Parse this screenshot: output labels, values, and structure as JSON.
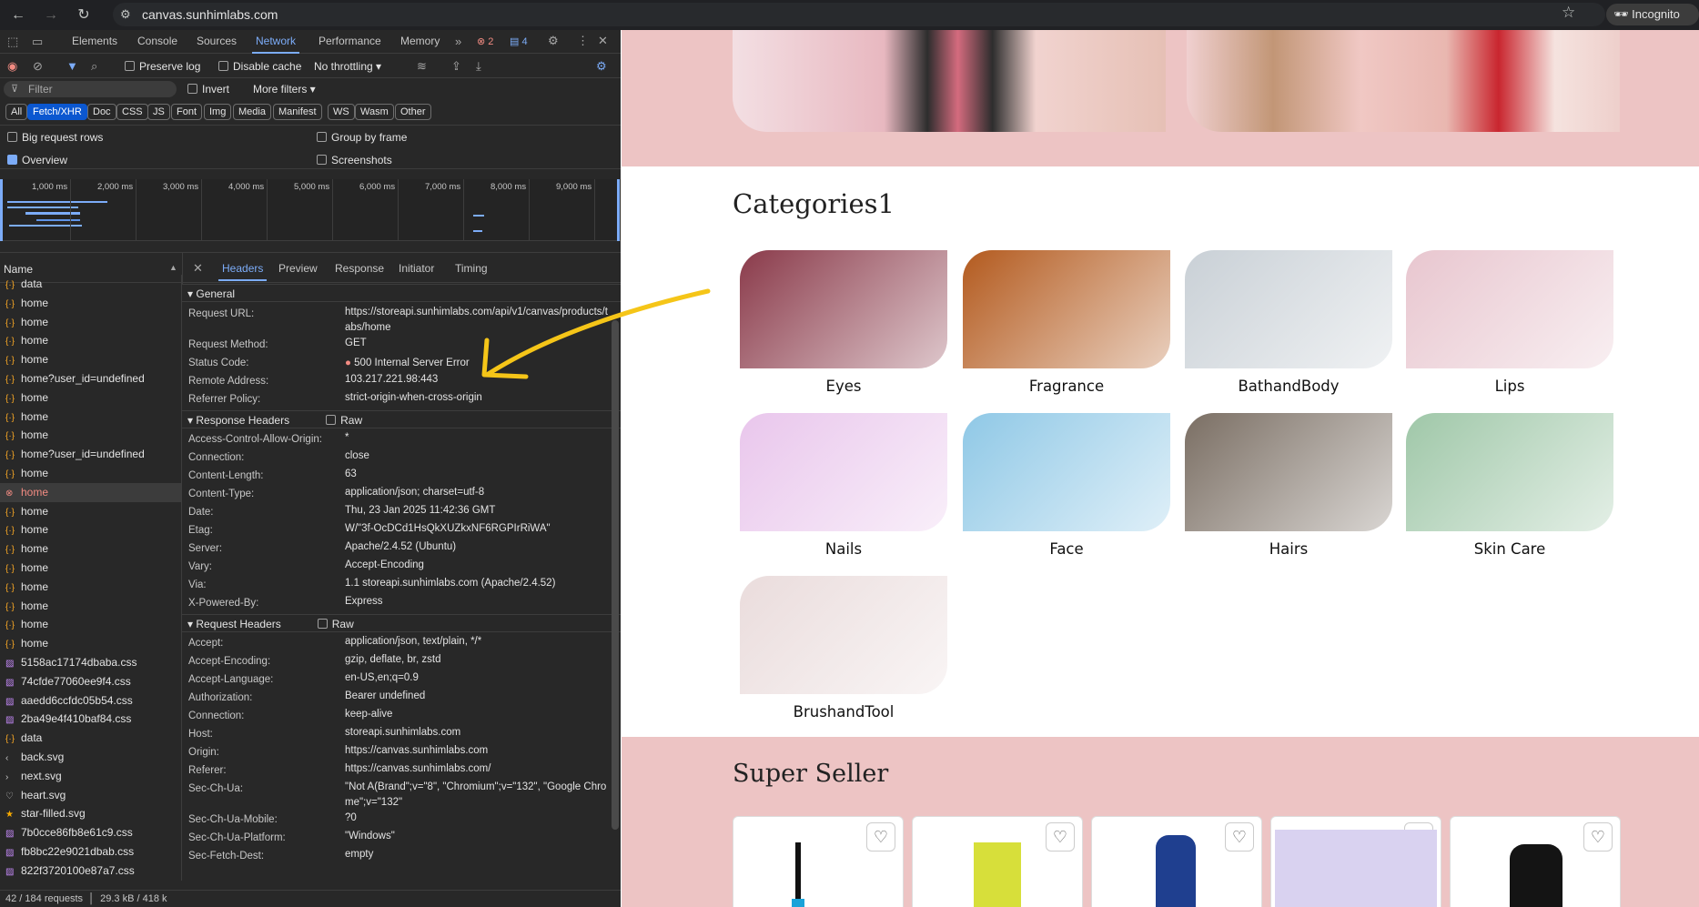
{
  "browser": {
    "url": "canvas.sunhimlabs.com",
    "profile": "Incognito (2)"
  },
  "devtools": {
    "tabs": [
      "Elements",
      "Console",
      "Sources",
      "Network",
      "Performance",
      "Memory"
    ],
    "active_tab": "Network",
    "error_count": "2",
    "message_count": "4",
    "toolbar": {
      "preserve_log": "Preserve log",
      "disable_cache": "Disable cache",
      "throttling": "No throttling"
    },
    "filter": {
      "placeholder": "Filter",
      "invert": "Invert",
      "more_filters": "More filters"
    },
    "type_filters": [
      "All",
      "Fetch/XHR",
      "Doc",
      "CSS",
      "JS",
      "Font",
      "Img",
      "Media",
      "Manifest",
      "WS",
      "Wasm",
      "Other"
    ],
    "active_type": "Fetch/XHR",
    "options": {
      "big_rows": "Big request rows",
      "group_by_frame": "Group by frame",
      "overview": "Overview",
      "screenshots": "Screenshots"
    },
    "timeline_ticks": [
      "1,000 ms",
      "2,000 ms",
      "3,000 ms",
      "4,000 ms",
      "5,000 ms",
      "6,000 ms",
      "7,000 ms",
      "8,000 ms",
      "9,000 ms"
    ],
    "name_header": "Name",
    "requests": [
      {
        "name": "data",
        "type": "xhr"
      },
      {
        "name": "home",
        "type": "xhr"
      },
      {
        "name": "home",
        "type": "xhr"
      },
      {
        "name": "home",
        "type": "xhr"
      },
      {
        "name": "home",
        "type": "xhr"
      },
      {
        "name": "home?user_id=undefined",
        "type": "xhr"
      },
      {
        "name": "home",
        "type": "xhr"
      },
      {
        "name": "home",
        "type": "xhr"
      },
      {
        "name": "home",
        "type": "xhr"
      },
      {
        "name": "home?user_id=undefined",
        "type": "xhr"
      },
      {
        "name": "home",
        "type": "xhr"
      },
      {
        "name": "home",
        "type": "error"
      },
      {
        "name": "home",
        "type": "xhr"
      },
      {
        "name": "home",
        "type": "xhr"
      },
      {
        "name": "home",
        "type": "xhr"
      },
      {
        "name": "home",
        "type": "xhr"
      },
      {
        "name": "home",
        "type": "xhr"
      },
      {
        "name": "home",
        "type": "xhr"
      },
      {
        "name": "home",
        "type": "xhr"
      },
      {
        "name": "home",
        "type": "xhr"
      },
      {
        "name": "5158ac17174dbaba.css",
        "type": "css"
      },
      {
        "name": "74cfde77060ee9f4.css",
        "type": "css"
      },
      {
        "name": "aaedd6ccfdc05b54.css",
        "type": "css"
      },
      {
        "name": "2ba49e4f410baf84.css",
        "type": "css"
      },
      {
        "name": "data",
        "type": "xhr"
      },
      {
        "name": "back.svg",
        "type": "svg-back"
      },
      {
        "name": "next.svg",
        "type": "svg-next"
      },
      {
        "name": "heart.svg",
        "type": "svg-heart"
      },
      {
        "name": "star-filled.svg",
        "type": "svg-star"
      },
      {
        "name": "7b0cce86fb8e61c9.css",
        "type": "css"
      },
      {
        "name": "fb8bc22e9021dbab.css",
        "type": "css"
      },
      {
        "name": "822f3720100e87a7.css",
        "type": "css"
      }
    ],
    "detail_tabs": [
      "Headers",
      "Preview",
      "Response",
      "Initiator",
      "Timing"
    ],
    "active_detail_tab": "Headers",
    "general": {
      "title": "General",
      "rows": [
        {
          "k": "Request URL:",
          "v": "https://storeapi.sunhimlabs.com/api/v1/canvas/products/tabs/home"
        },
        {
          "k": "Request Method:",
          "v": "GET"
        },
        {
          "k": "Status Code:",
          "v": "500 Internal Server Error"
        },
        {
          "k": "Remote Address:",
          "v": "103.217.221.98:443"
        },
        {
          "k": "Referrer Policy:",
          "v": "strict-origin-when-cross-origin"
        }
      ]
    },
    "response_headers": {
      "title": "Response Headers",
      "raw": "Raw",
      "rows": [
        {
          "k": "Access-Control-Allow-Origin:",
          "v": "*"
        },
        {
          "k": "Connection:",
          "v": "close"
        },
        {
          "k": "Content-Length:",
          "v": "63"
        },
        {
          "k": "Content-Type:",
          "v": "application/json; charset=utf-8"
        },
        {
          "k": "Date:",
          "v": "Thu, 23 Jan 2025 11:42:36 GMT"
        },
        {
          "k": "Etag:",
          "v": "W/\"3f-OcDCd1HsQkXUZkxNF6RGPIrRiWA\""
        },
        {
          "k": "Server:",
          "v": "Apache/2.4.52 (Ubuntu)"
        },
        {
          "k": "Vary:",
          "v": "Accept-Encoding"
        },
        {
          "k": "Via:",
          "v": "1.1 storeapi.sunhimlabs.com (Apache/2.4.52)"
        },
        {
          "k": "X-Powered-By:",
          "v": "Express"
        }
      ]
    },
    "request_headers": {
      "title": "Request Headers",
      "raw": "Raw",
      "rows": [
        {
          "k": "Accept:",
          "v": "application/json, text/plain, */*"
        },
        {
          "k": "Accept-Encoding:",
          "v": "gzip, deflate, br, zstd"
        },
        {
          "k": "Accept-Language:",
          "v": "en-US,en;q=0.9"
        },
        {
          "k": "Authorization:",
          "v": "Bearer undefined"
        },
        {
          "k": "Connection:",
          "v": "keep-alive"
        },
        {
          "k": "Host:",
          "v": "storeapi.sunhimlabs.com"
        },
        {
          "k": "Origin:",
          "v": "https://canvas.sunhimlabs.com"
        },
        {
          "k": "Referer:",
          "v": "https://canvas.sunhimlabs.com/"
        },
        {
          "k": "Sec-Ch-Ua:",
          "v": "\"Not A(Brand\";v=\"8\", \"Chromium\";v=\"132\", \"Google Chrome\";v=\"132\""
        },
        {
          "k": "Sec-Ch-Ua-Mobile:",
          "v": "?0"
        },
        {
          "k": "Sec-Ch-Ua-Platform:",
          "v": "\"Windows\""
        },
        {
          "k": "Sec-Fetch-Dest:",
          "v": "empty"
        }
      ]
    },
    "status": "42 / 184 requests",
    "transfer": "29.3 kB / 418 k"
  },
  "page": {
    "categories_title": "Categories1",
    "categories": [
      {
        "name": "Eyes",
        "color": "#8a3a4a"
      },
      {
        "name": "Fragrance",
        "color": "#b35a1e"
      },
      {
        "name": "BathandBody",
        "color": "#c9d0d6"
      },
      {
        "name": "Lips",
        "color": "#e8c6cf"
      },
      {
        "name": "Nails",
        "color": "#e9c6ec"
      },
      {
        "name": "Face",
        "color": "#8fc8e6"
      },
      {
        "name": "Hairs",
        "color": "#7a6e63"
      },
      {
        "name": "Skin Care",
        "color": "#9fc7a8"
      },
      {
        "name": "BrushandTool",
        "color": "#eadcdc"
      }
    ],
    "super_seller_title": "Super Seller",
    "accent": "#edc4c4"
  }
}
